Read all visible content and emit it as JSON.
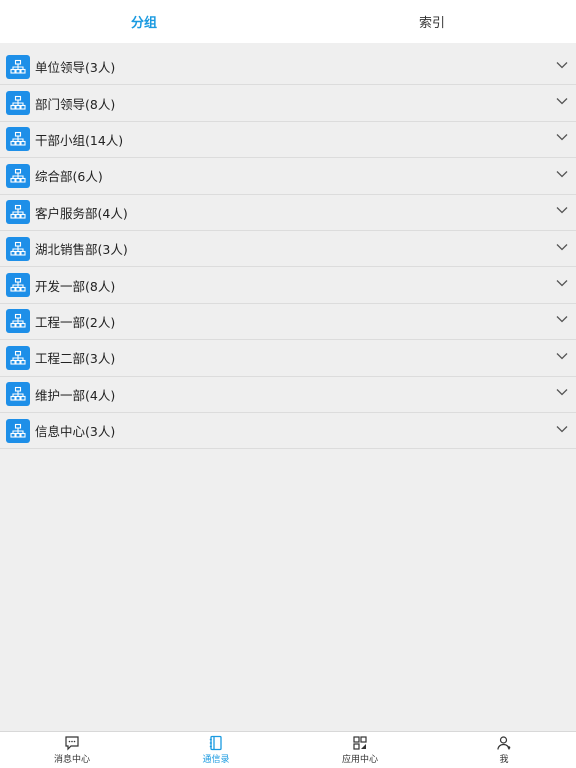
{
  "tabs": [
    {
      "label": "分组",
      "active": true
    },
    {
      "label": "索引",
      "active": false
    }
  ],
  "groups": [
    {
      "label": "单位领导(3人)"
    },
    {
      "label": "部门领导(8人)"
    },
    {
      "label": "干部小组(14人)"
    },
    {
      "label": "综合部(6人)"
    },
    {
      "label": "客户服务部(4人)"
    },
    {
      "label": "湖北销售部(3人)"
    },
    {
      "label": "开发一部(8人)"
    },
    {
      "label": "工程一部(2人)"
    },
    {
      "label": "工程二部(3人)"
    },
    {
      "label": "维护一部(4人)"
    },
    {
      "label": "信息中心(3人)"
    }
  ],
  "group_icon": "org-chart-icon",
  "expand_icon": "chevron-down-icon",
  "bottom_nav": [
    {
      "label": "消息中心",
      "icon": "message-icon",
      "active": false
    },
    {
      "label": "通信录",
      "icon": "contacts-book-icon",
      "active": true
    },
    {
      "label": "应用中心",
      "icon": "apps-grid-icon",
      "active": false
    },
    {
      "label": "我",
      "icon": "user-icon",
      "active": false
    }
  ],
  "colors": {
    "accent": "#1a9ae0",
    "icon_bg": "#1e8fe8",
    "background": "#efefef"
  }
}
